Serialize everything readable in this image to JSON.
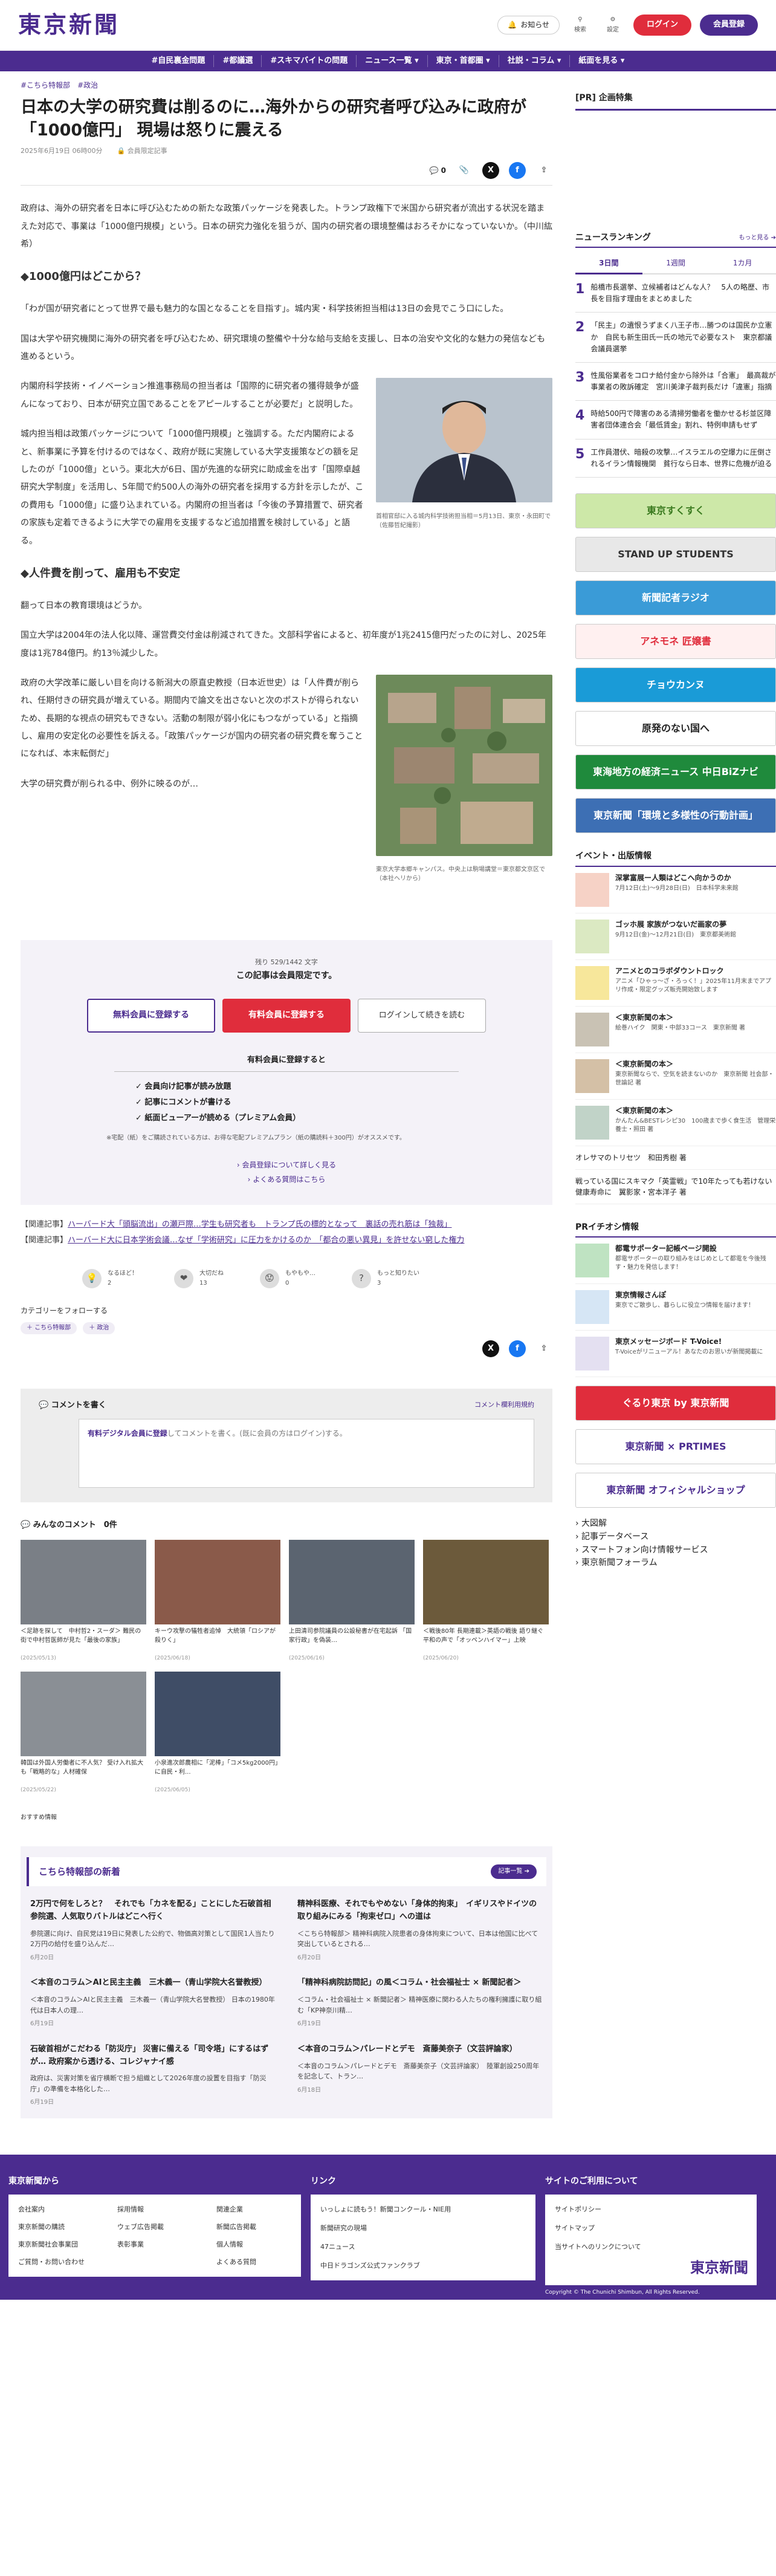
{
  "header": {
    "logo": "東京新聞",
    "notice": "お知らせ",
    "search": "検索",
    "settings": "設定",
    "login": "ログイン",
    "register": "会員登録",
    "brand_color": "#4b2c8f"
  },
  "nav": [
    "#自民裏金問題",
    "#都議選",
    "#スキマバイトの問題",
    "ニュース一覧 ▾",
    "東京・首都圏 ▾",
    "社説・コラム ▾",
    "紙面を見る ▾"
  ],
  "article": {
    "tags": [
      "#こちら特報部",
      "#政治"
    ],
    "title": "日本の大学の研究費は削るのに…海外からの研究者呼び込みに政府が「1000億円」 現場は怒りに震える",
    "date": "2025年6月19日 06時00分",
    "member": "会員限定記事",
    "comment_count": "0",
    "p1": "政府は、海外の研究者を日本に呼び込むための新たな政策パッケージを発表した。トランプ政権下で米国から研究者が流出する状況を踏まえた対応で、事業は「1000億円規模」という。日本の研究力強化を狙うが、国内の研究者の環境整備はおろそかになっていないか。（中川紘希）",
    "h1": "◆1000億円はどこから？",
    "p2": "「わが国が研究者にとって世界で最も魅力的な国となることを目指す」。城内実・科学技術担当相は13日の会見でこう口にした。",
    "p3": "国は大学や研究機関に海外の研究者を呼び込むため、研究環境の整備や十分な給与支給を支援し、日本の治安や文化的な魅力の発信なども進めるという。",
    "p4": "内閣府科学技術・イノベーション推進事務局の担当者は「国際的に研究者の獲得競争が盛んになっており、日本が研究立国であることをアピールすることが必要だ」と説明した。",
    "p5": "城内担当相は政策パッケージについて「1000億円規模」と強調する。ただ内閣府によると、新事業に予算を付けるのではなく、政府が既に実施している大学支援策などの額を足したのが「1000億」という。東北大が6日、国が先進的な研究に助成金を出す「国際卓越研究大学制度」を活用し、5年間で約500人の海外の研究者を採用する方針を示したが、この費用も「1000億」に盛り込まれている。内閣府の担当者は「今後の予算措置で、研究者の家族も定着できるように大学での雇用を支援するなど追加措置を検討している」と語る。",
    "h2": "◆人件費を削って、雇用も不安定",
    "p6": "翻って日本の教育環境はどうか。",
    "p7": "国立大学は2004年の法人化以降、運営費交付金は削減されてきた。文部科学省によると、初年度が1兆2415億円だったのに対し、2025年度は1兆784億円。約13％減少した。",
    "p8": "政府の大学改革に厳しい目を向ける新潟大の原直史教授（日本近世史）は「人件費が削られ、任期付きの研究員が増えている。期間内で論文を出さないと次のポストが得られないため、長期的な視点の研究もできない。活動の制限が弱小化にもつながっている」と指摘し、雇用の安定化の必要性を訴える。「政策パッケージが国内の研究者の研究費を奪うことになれば、本末転倒だ」",
    "p9": "大学の研究費が削られる中、例外に映るのが…",
    "fig1_caption": "首相官邸に入る城内科学技術担当相＝5月13日、東京・永田町で（佐藤哲紀撮影）",
    "fig2_caption": "東京大学本郷キャンパス。中央上は駒場講堂＝東京都文京区で（本社ヘリから）"
  },
  "paywall": {
    "count": "残り 529/1442 文字",
    "heading": "この記事は会員限定です。",
    "free": "無料会員に登録する",
    "paid": "有料会員に登録する",
    "login": "ログインして続きを読む",
    "benefit_title": "有料会員に登録すると",
    "benefits": [
      "✓ 会員向け記事が読み放題",
      "✓ 記事にコメントが書ける",
      "✓ 紙面ビューアーが読める（プレミアム会員）"
    ],
    "note": "※宅配（紙）をご購読されている方は、お得な宅配プレミアムプラン（紙の購読料＋300円）がオススメです。",
    "link1": "会員登録について詳しく見る",
    "link2": "よくある質問はこちら"
  },
  "related": [
    {
      "label": "【関連記事】",
      "text": "ハーバード大「頭脳流出」の瀬戸際…学生も研究者も　トランプ氏の標的となって　裏話の売れ筋は「独裁」"
    },
    {
      "label": "【関連記事】",
      "text": "ハーバード大に日本学術会議…なぜ「学術研究」に圧力をかけるのか　「都合の悪い異見」を許せない窮した権力"
    }
  ],
  "reactions": [
    {
      "label": "なるほど！",
      "count": "2",
      "emoji": "💡"
    },
    {
      "label": "大切だね",
      "count": "13",
      "emoji": "❤"
    },
    {
      "label": "もやもや…",
      "count": "0",
      "emoji": "😟"
    },
    {
      "label": "もっと知りたい",
      "count": "3",
      "emoji": "?"
    }
  ],
  "category": {
    "title": "カテゴリーをフォローする",
    "chips": [
      "＋ こちら特報部",
      "＋ 政治"
    ]
  },
  "comment": {
    "title": "コメントを書く",
    "rules": "コメント欄利用規約",
    "placeholder_link": "有料デジタル会員に登録",
    "placeholder": "してコメントを書く。(既に会員の方はログイン)する。"
  },
  "member_comments": {
    "title": "みんなのコメント",
    "count": "0件",
    "items": [
      {
        "cap": "＜足跡を探して　中村哲2・スーダ＞ 難民の街で中村哲医師が見た「最後の家族」",
        "date": "(2025/05/13)"
      },
      {
        "cap": "キーウ攻撃の犠牲者追悼　大統領「ロシアが殺りく」",
        "date": "(2025/06/18)"
      },
      {
        "cap": "上田清司参院議員の公設秘書が在宅起訴 「国家行政」を偽装…",
        "date": "(2025/06/16)"
      },
      {
        "cap": "＜戦後80年 長期連載＞英語の戦後 語り継ぐ 平和の声で「オッペンハイマー」上映",
        "date": "(2025/06/20)"
      },
      {
        "cap": "韓国は外国人労働者に不人気？ 受け入れ拡大も「戦略的な」人材確保",
        "date": "(2025/05/22)"
      },
      {
        "cap": "小泉進次郎農相に「泥棒」「コメ5kg2000円」に自民・利...",
        "date": "(2025/06/05)"
      }
    ]
  },
  "recommend": "おすすめ情報",
  "special": {
    "title": "こちら特報部の新着",
    "more": "記事一覧 ➔",
    "items": [
      {
        "title": "2万円で何をしろと？　それでも「カネを配る」ことにした石破首相　参院選、人気取りバトルはどこへ行く",
        "sum": "参院選に向け、自民党は19日に発表した公約で、物価高対策として国民1人当たり2万円の給付を盛り込んだ…",
        "d": "6月20日"
      },
      {
        "title": "精神科医療、それでもやめない「身体的拘束」　イギリスやドイツの取り組みにみる「拘束ゼロ」への道は",
        "sum": "＜こちら特報部＞ 精神科病院入院患者の身体拘束について、日本は他国に比べて突出しているとされる…",
        "d": "6月20日"
      },
      {
        "title": "＜本音のコラム＞AIと民主主義　三木義一（青山学院大名誉教授）",
        "sum": "＜本音のコラム＞AIと民主主義　三木義一（青山学院大名誉教授） 日本の1980年代は日本人の理…",
        "d": "6月19日"
      },
      {
        "title": "「精神科病院訪問記」の風＜コラム・社会福祉士 × 新聞記者＞",
        "sum": "＜コラム・社会福祉士 × 新聞記者＞ 精神医療に関わる人たちの権利擁護に取り組む「KP神奈川精…",
        "d": "6月19日"
      },
      {
        "title": "石破首相がこだわる「防災庁」 災害に備える「司令塔」にするはずが… 政府案から透ける、コレジャナイ感",
        "sum": "政府は、災害対策を省庁横断で担う組織として2026年度の設置を目指す「防災庁」の準備を本格化した…",
        "d": "6月19日"
      },
      {
        "title": "＜本音のコラム＞パレードとデモ　斎藤美奈子（文芸評論家）",
        "sum": "＜本音のコラム＞パレードとデモ　斎藤美奈子（文芸評論家）　陸軍創設250周年を記念して、トラン…",
        "d": "6月18日"
      }
    ]
  },
  "sidebar": {
    "pr": "[PR] 企画特集",
    "ranking_title": "ニュースランキング",
    "ranking_more": "もっと見る ➔",
    "tabs": [
      "3日間",
      "1週間",
      "1カ月"
    ],
    "ranking": [
      {
        "n": "1",
        "t": "船橋市長選挙、立候補者はどんな人？　5人の略歴、市長を目指す理由をまとめました"
      },
      {
        "n": "2",
        "t": "「民主」の遺恨うずまく八王子市…勝つのは国民か立憲か　自民も新生田氏一氏の地元で必要なスト　東京都議会議員選挙"
      },
      {
        "n": "3",
        "t": "性風俗業者をコロナ給付金から除外は「合憲」　最高裁が事業者の敗訴確定　宮川美津子裁判長だけ「違憲」指摘"
      },
      {
        "n": "4",
        "t": "時給500円で障害のある清掃労働者を働かせる杉並区障害者団体連合会「最低賃金」割れ、特例申請もせず"
      },
      {
        "n": "5",
        "t": "工作員潜伏、暗殺の攻撃…イスラエルの空爆力に圧倒されるイラン情報機関　貧行なら日本、世界に危機が迫る"
      }
    ],
    "banners": [
      {
        "text": "東京すくすく",
        "bg": "#cde8a8",
        "fg": "#3a7a1f"
      },
      {
        "text": "STAND UP STUDENTS",
        "bg": "#e8e8e8",
        "fg": "#333"
      },
      {
        "text": "新聞記者ラジオ",
        "bg": "#3a9bd7",
        "fg": "#fff"
      },
      {
        "text": "アネモネ 匠嬢書",
        "bg": "#fff0f0",
        "fg": "#e02d3c"
      },
      {
        "text": "チョウカンヌ",
        "bg": "#1a9bd7",
        "fg": "#fff"
      },
      {
        "text": "原発のない国へ",
        "bg": "#ffffff",
        "fg": "#222"
      },
      {
        "text": "東海地方の経済ニュース 中日BiZナビ",
        "bg": "#1f8a3c",
        "fg": "#fff"
      },
      {
        "text": "東京新聞「環境と多様性の行動計画」",
        "bg": "#3d6fb4",
        "fg": "#fff"
      }
    ],
    "event_title": "イベント・出版情報",
    "events": [
      {
        "t": "深掌富展ー人類はどこへ向かうのか",
        "s": "7月12日(土)〜9月28日(日)　日本科学未来館"
      },
      {
        "t": "ゴッホ展 家族がつないだ画家の夢",
        "s": "9月12日(金)〜12月21日(日)　東京都美術館"
      },
      {
        "t": "アニメとのコラボダウントロック",
        "s": "アニメ「ひゃっ〜ざ・ろっく！」2025年11月末までアプリ作成・限定グッズ販売開始致します"
      },
      {
        "t": "＜東京新聞の本＞",
        "s": "絵巻ハイク　関東・中部33コース　東京新聞 著"
      },
      {
        "t": "＜東京新聞の本＞",
        "s": "東京新聞ならで、空気を読まないのか　東京新聞 社会部・世論記 著"
      },
      {
        "t": "＜東京新聞の本＞",
        "s": "かんたん&BESTレシピ30　100歳まで歩く食生活　管理栄養士・照田 著"
      }
    ],
    "links": [
      "オレサマのトリセツ　和田秀樹 著",
      "戦っている国にスキマク「英霊戦」で10年たっても若けない健康寿命に　翼影家・宮本洋子 著"
    ],
    "pr_info_title": "PRイチオシ情報",
    "pr_items": [
      {
        "t": "都電サポーター記帳ページ開設",
        "s": "都電サポーターの取り組みをはじめとして都電を今後残す・魅力を発信します！"
      },
      {
        "t": "東京情報さんぽ",
        "s": "東京でご散歩し、暮らしに役立つ情報を届けます！"
      },
      {
        "t": "東京メッセージボード T-Voice!",
        "s": "T-Voiceがリニューアル！あなたのお思いが新聞掲載に"
      }
    ],
    "banners2": [
      {
        "text": "ぐるり東京 by 東京新聞",
        "bg": "#e02d3c",
        "fg": "#fff"
      },
      {
        "text": "東京新聞 × PRTIMES",
        "bg": "#ffffff",
        "fg": "#4b2c8f"
      },
      {
        "text": "東京新聞 オフィシャルショップ",
        "bg": "#ffffff",
        "fg": "#4b2c8f"
      }
    ],
    "menu": [
      "› 大図解",
      "› 記事データベース",
      "› スマートフォン向け情報サービス",
      "› 東京新聞フォーラム"
    ]
  },
  "footer": {
    "col1_title": "東京新聞から",
    "col1": [
      "会社案内",
      "採用情報",
      "関連企業",
      "東京新聞の購読",
      "ウェブ広告掲載",
      "新聞広告掲載",
      "東京新聞社会事業団",
      "表彰事業",
      "個人情報",
      "ご質問・お問い合わせ",
      "",
      "よくある質問"
    ],
    "col2_title": "リンク",
    "col2": [
      "いっしょに読もう！新聞コンクール・NIE用",
      "新聞研究の現場",
      "47ニュース",
      "中日ドラゴンズ公式ファンクラブ"
    ],
    "col3_title": "サイトのご利用について",
    "col3": [
      "サイトポリシー",
      "サイトマップ",
      "当サイトへのリンクについて"
    ],
    "copyright": "Copyright © The Chunichi Shimbun, All Rights Reserved."
  }
}
